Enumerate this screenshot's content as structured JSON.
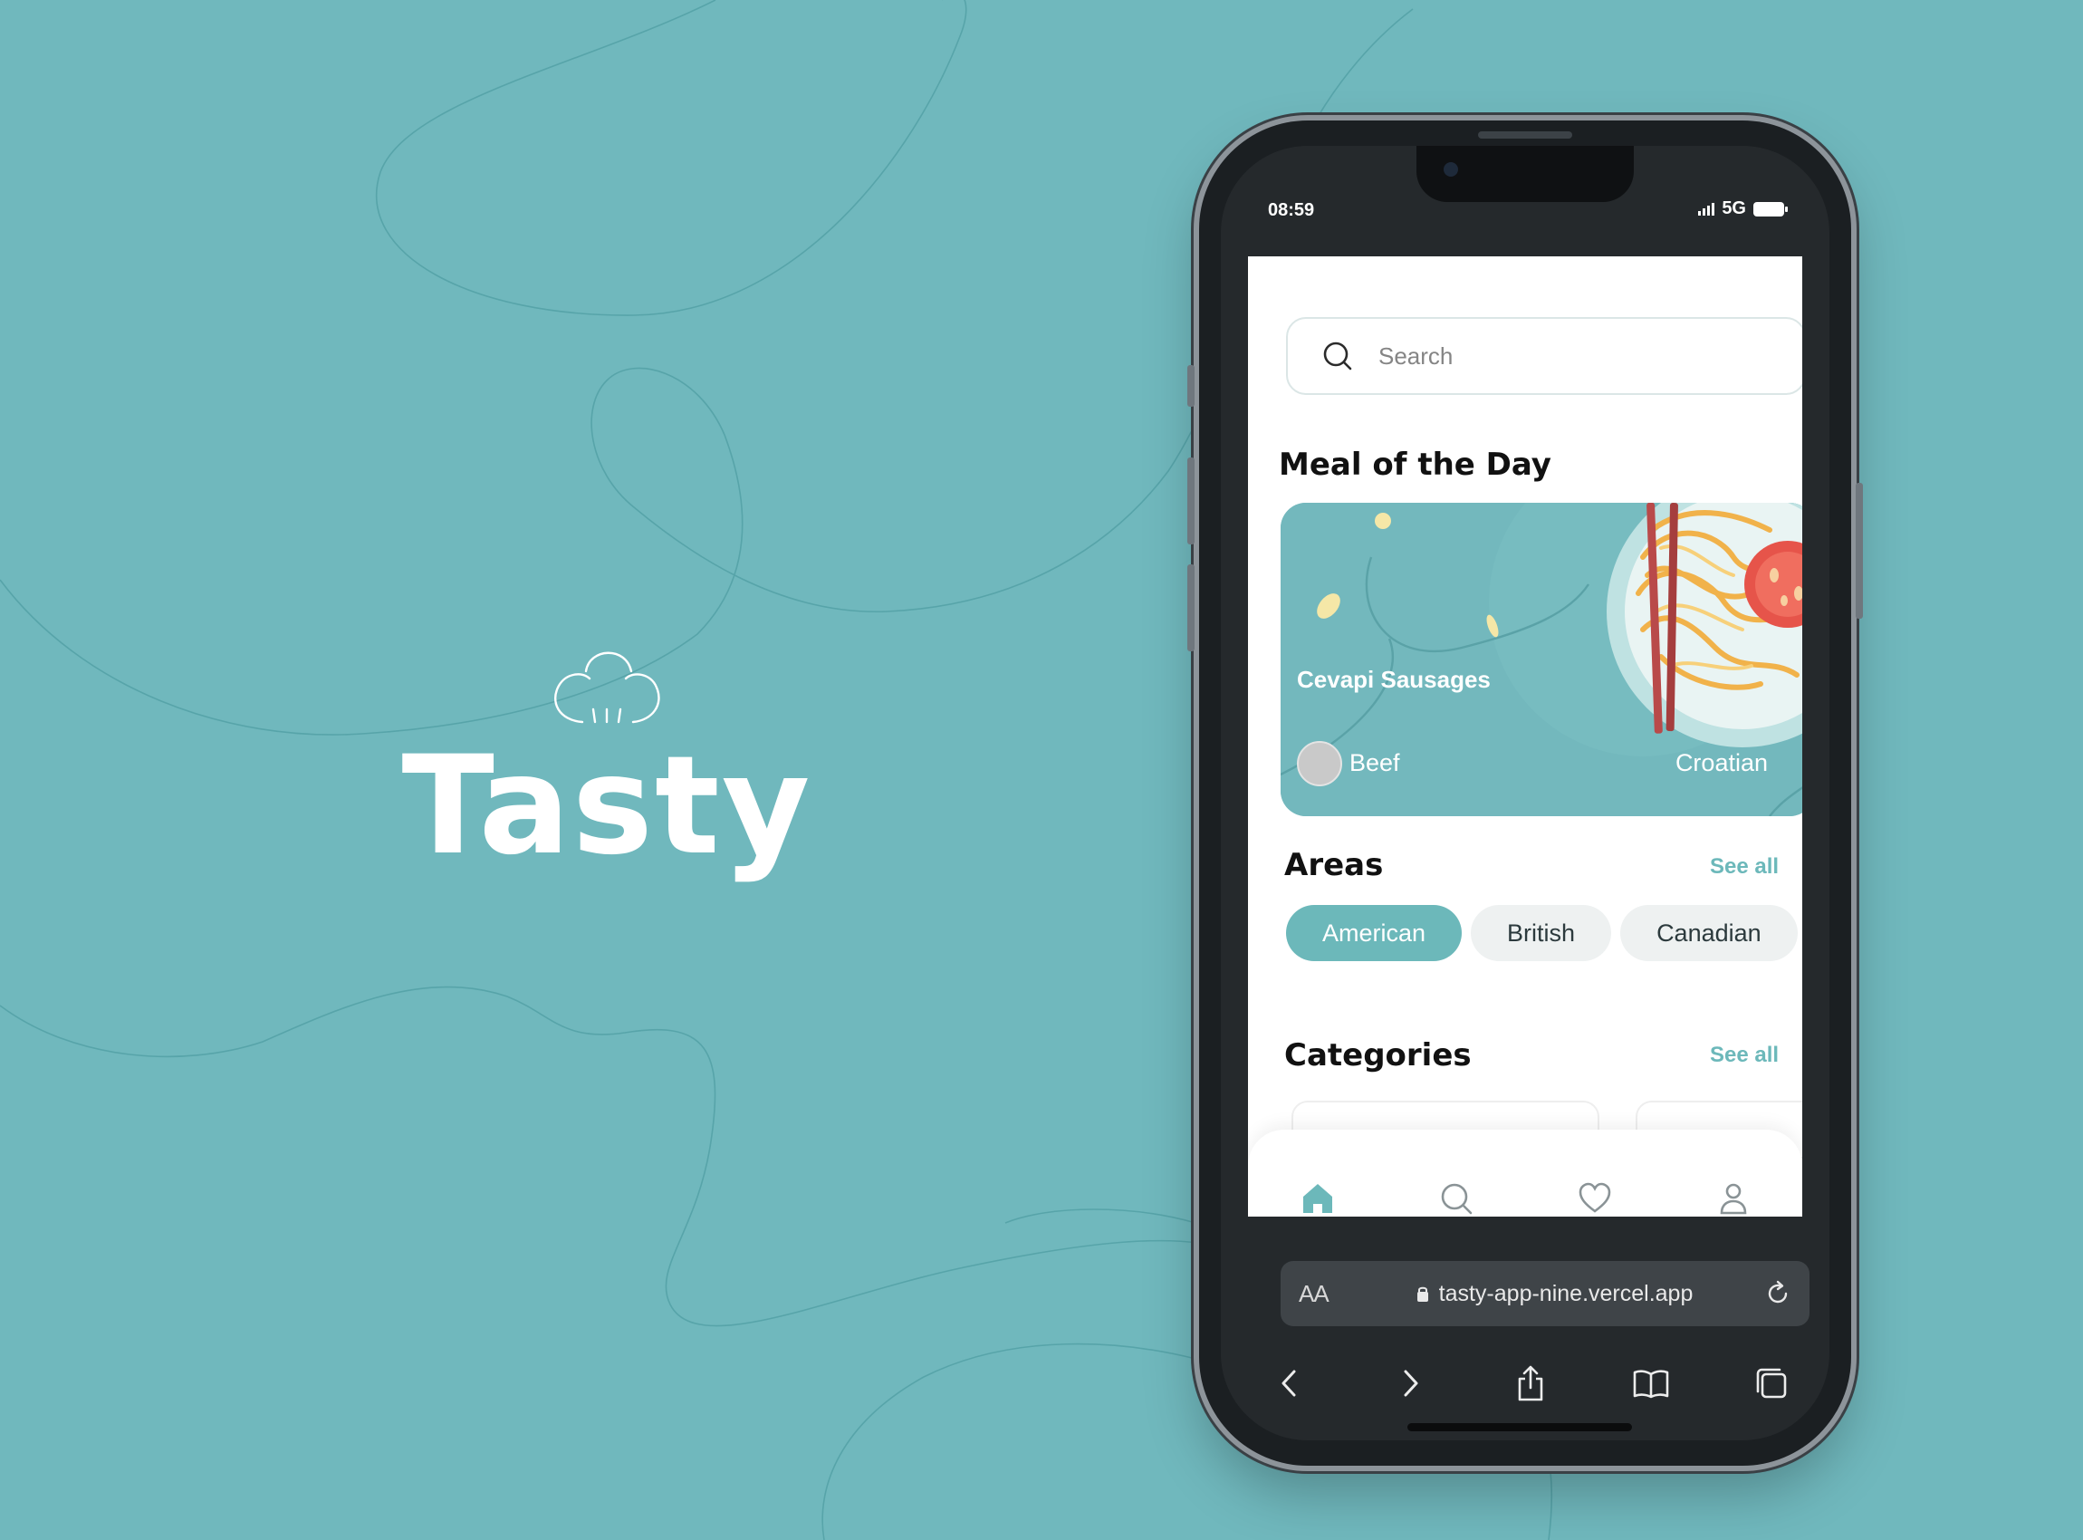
{
  "brand": {
    "name": "Tasty",
    "logo_icon": "chef-hat-icon"
  },
  "colors": {
    "background": "#70b8bd",
    "accent": "#6cb8ba",
    "phone_frame": "#1b1f22"
  },
  "status_bar": {
    "time": "08:59",
    "network": "5G",
    "signal_icon": "signal-bars-icon",
    "battery_icon": "battery-icon"
  },
  "search": {
    "placeholder": "Search",
    "icon": "search-icon"
  },
  "meal_of_the_day": {
    "title": "Meal of the Day",
    "meal_name": "Cevapi Sausages",
    "category": "Beef",
    "area": "Croatian"
  },
  "areas": {
    "title": "Areas",
    "see_all": "See all",
    "chips": [
      {
        "label": "American",
        "active": true
      },
      {
        "label": "British",
        "active": false
      },
      {
        "label": "Canadian",
        "active": false
      }
    ]
  },
  "categories": {
    "title": "Categories",
    "see_all": "See all"
  },
  "tab_bar": {
    "items": [
      "home-icon",
      "search-icon",
      "heart-icon",
      "user-icon"
    ],
    "active": "home-icon"
  },
  "browser": {
    "text_size_label": "AA",
    "url": "tasty-app-nine.vercel.app",
    "lock_icon": "lock-icon",
    "reload_icon": "reload-icon",
    "toolbar": [
      "back-icon",
      "forward-icon",
      "share-icon",
      "bookmarks-icon",
      "tabs-icon"
    ]
  }
}
